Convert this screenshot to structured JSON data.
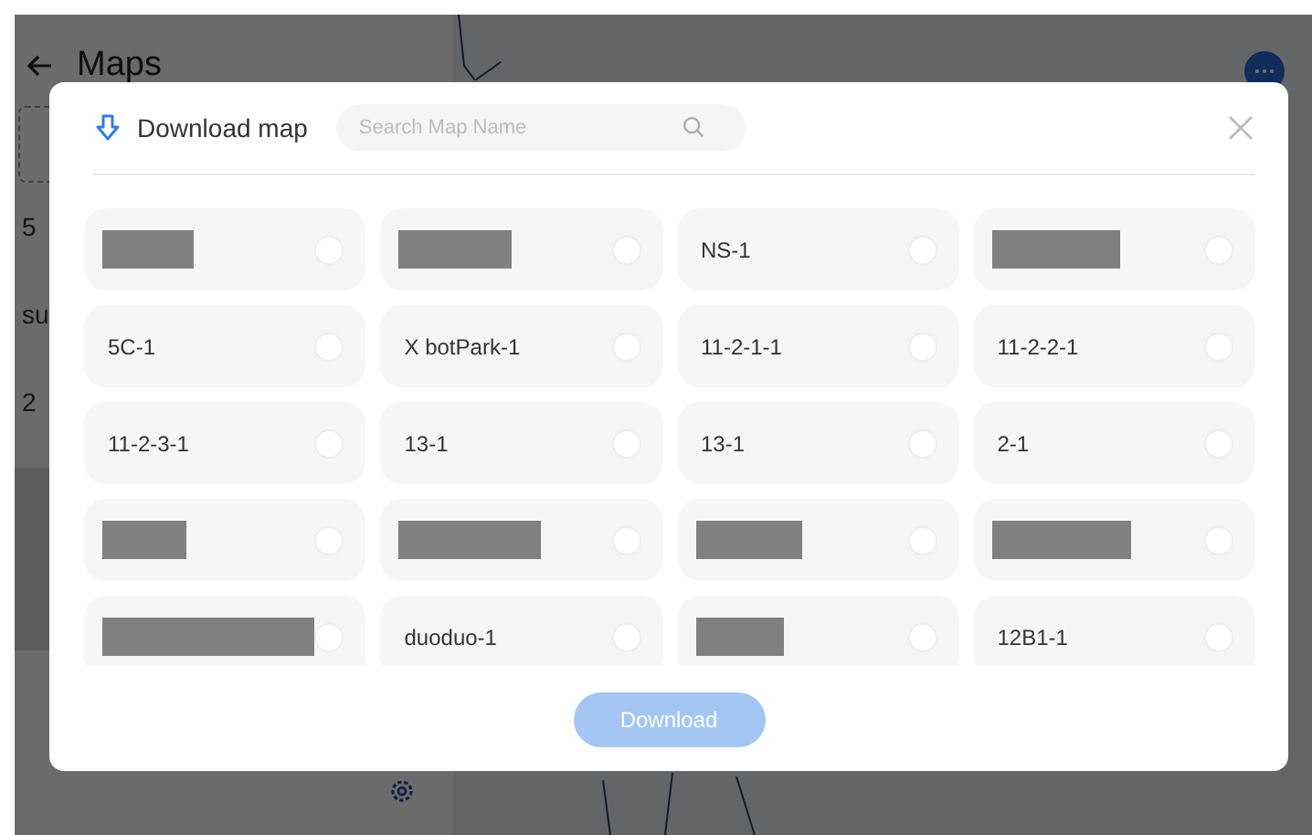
{
  "app": {
    "title": "Maps",
    "list_items": [
      "5",
      "su",
      "2"
    ]
  },
  "dialog": {
    "title": "Download map",
    "search": {
      "placeholder": "Search Map Name"
    },
    "maps": [
      {
        "kind": "redacted",
        "selected": false
      },
      {
        "kind": "redacted",
        "selected": false
      },
      {
        "kind": "name",
        "name": "NS-1",
        "selected": false
      },
      {
        "kind": "redacted",
        "selected": false
      },
      {
        "kind": "name",
        "name": "5C-1",
        "selected": false
      },
      {
        "kind": "name",
        "name": "X botPark-1",
        "selected": false
      },
      {
        "kind": "name",
        "name": "11-2-1-1",
        "selected": false
      },
      {
        "kind": "name",
        "name": "11-2-2-1",
        "selected": false
      },
      {
        "kind": "name",
        "name": "11-2-3-1",
        "selected": false
      },
      {
        "kind": "name",
        "name": "13-1",
        "selected": false
      },
      {
        "kind": "name",
        "name": "13-1",
        "selected": false
      },
      {
        "kind": "name",
        "name": "2-1",
        "selected": false
      },
      {
        "kind": "redacted",
        "selected": false
      },
      {
        "kind": "redacted",
        "selected": false
      },
      {
        "kind": "redacted",
        "selected": false
      },
      {
        "kind": "redacted",
        "selected": false
      },
      {
        "kind": "redacted",
        "selected": false
      },
      {
        "kind": "name",
        "name": "duoduo-1",
        "selected": false
      },
      {
        "kind": "redacted",
        "selected": false
      },
      {
        "kind": "name",
        "name": "12B1-1",
        "selected": false
      }
    ],
    "download_button": {
      "label": "Download",
      "disabled": true
    }
  }
}
